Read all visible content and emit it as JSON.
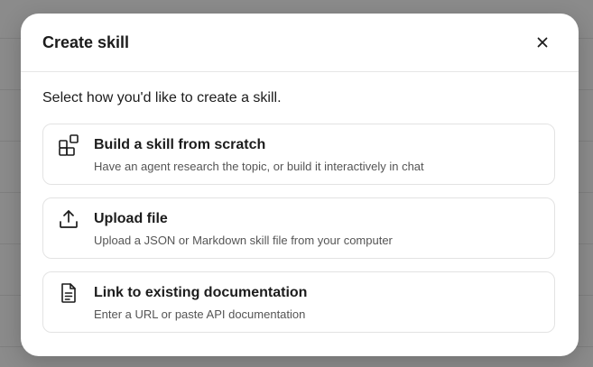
{
  "dialog": {
    "title": "Create skill",
    "subtitle": "Select how you'd like to create a skill.",
    "close_icon": "close-icon"
  },
  "options": [
    {
      "icon": "blocks-icon",
      "title": "Build a skill from scratch",
      "description": "Have an agent research the topic, or build it interactively in chat"
    },
    {
      "icon": "upload-icon",
      "title": "Upload file",
      "description": "Upload a JSON or Markdown skill file from your computer"
    },
    {
      "icon": "document-icon",
      "title": "Link to existing documentation",
      "description": "Enter a URL or paste API documentation"
    }
  ],
  "colors": {
    "backdrop": "#8b8b8b",
    "dialog_bg": "#ffffff",
    "card_border": "#e3e3e3",
    "text_primary": "#1c1c1c",
    "text_secondary": "#555555"
  }
}
